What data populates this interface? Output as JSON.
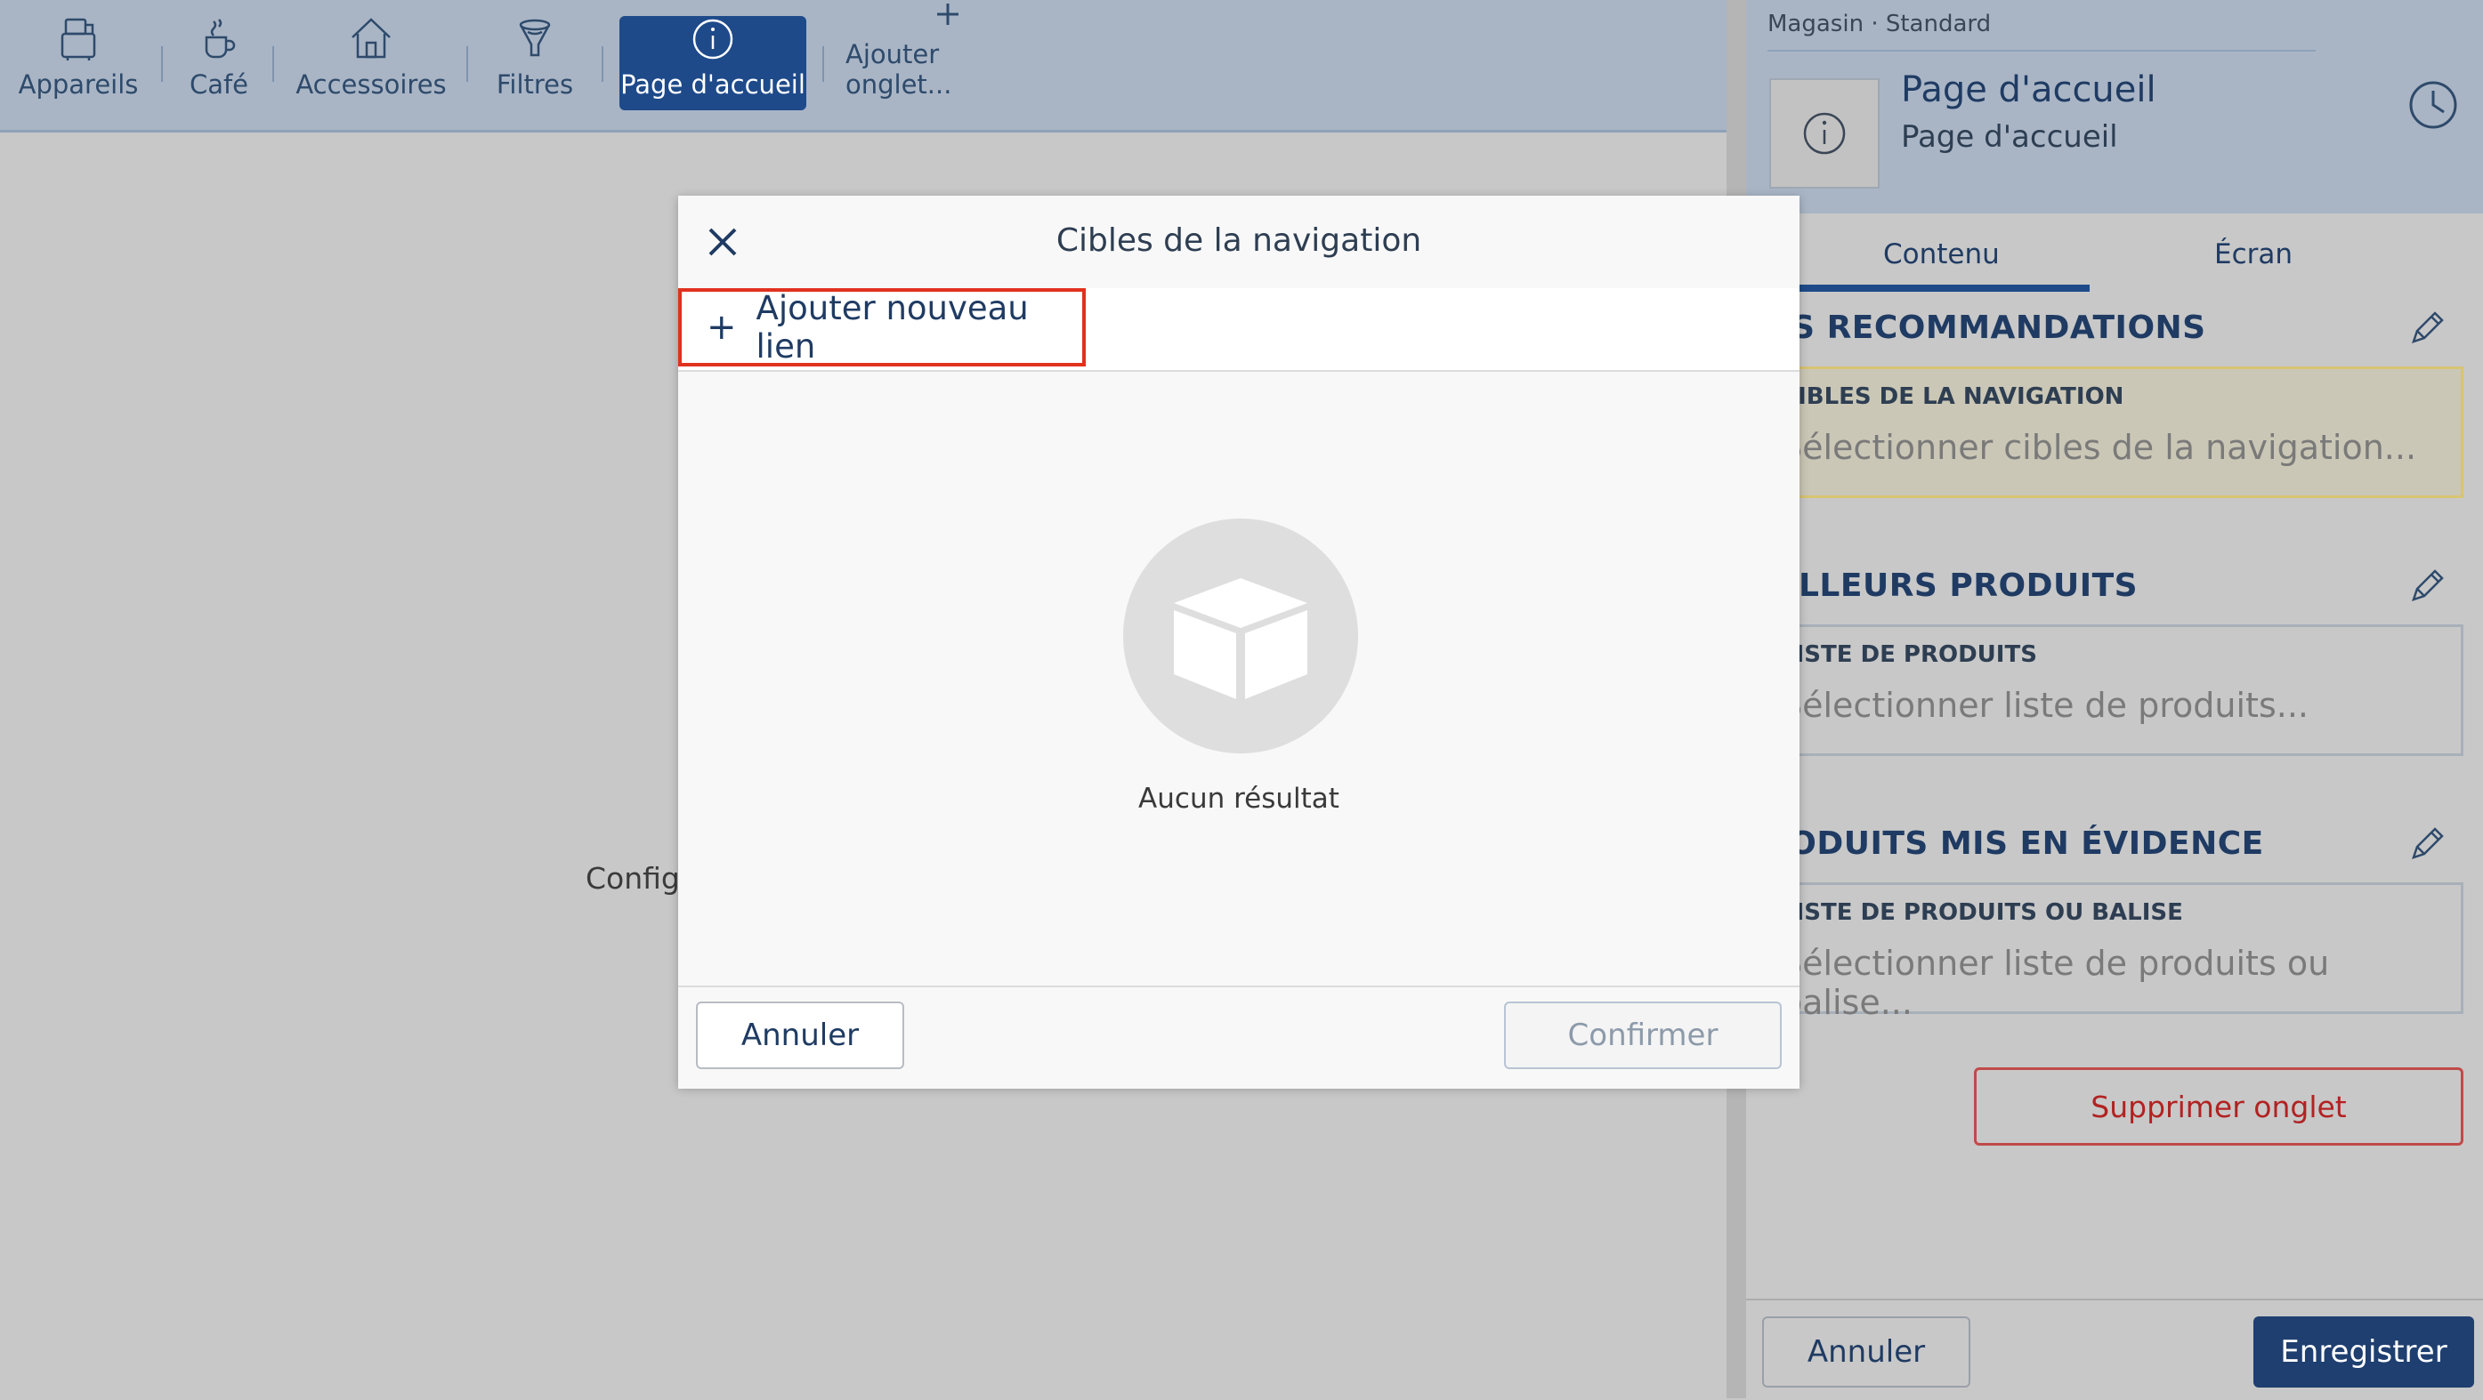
{
  "topbar": {
    "tabs": [
      {
        "label": "Appareils",
        "icon": "appliances-icon"
      },
      {
        "label": "Café",
        "icon": "coffee-cup-icon"
      },
      {
        "label": "Accessoires",
        "icon": "home-icon"
      },
      {
        "label": "Filtres",
        "icon": "filter-icon"
      },
      {
        "label": "Page d'accueil",
        "icon": "info-icon",
        "active": true
      },
      {
        "label": "Ajouter onglet...",
        "icon": "plus-icon"
      }
    ]
  },
  "main": {
    "config_text": "Config"
  },
  "right_panel": {
    "breadcrumb": "Magasin · Standard",
    "title": "Page d'accueil",
    "subtitle": "Page d'accueil",
    "tabs": [
      "Contenu",
      "Écran"
    ],
    "sections": [
      {
        "title": "OS RECOMMANDATIONS",
        "field_label": "CIBLES DE LA NAVIGATION",
        "placeholder": "Sélectionner cibles de la navigation..."
      },
      {
        "title": "EILLEURS PRODUITS",
        "field_label": "LISTE DE PRODUITS",
        "placeholder": "Sélectionner liste de produits..."
      },
      {
        "title": "RODUITS MIS EN ÉVIDENCE",
        "field_label": "LISTE DE PRODUITS OU BALISE",
        "placeholder": "Sélectionner liste de produits ou balise..."
      }
    ],
    "delete_label": "Supprimer onglet",
    "cancel_label": "Annuler",
    "save_label": "Enregistrer"
  },
  "modal": {
    "title": "Cibles de la navigation",
    "add_link_label": "Ajouter nouveau lien",
    "empty_text": "Aucun résultat",
    "cancel_label": "Annuler",
    "confirm_label": "Confirmer"
  },
  "colors": {
    "accent": "#1e4a8a",
    "highlight_border": "#e1311f",
    "danger": "#b22222"
  }
}
